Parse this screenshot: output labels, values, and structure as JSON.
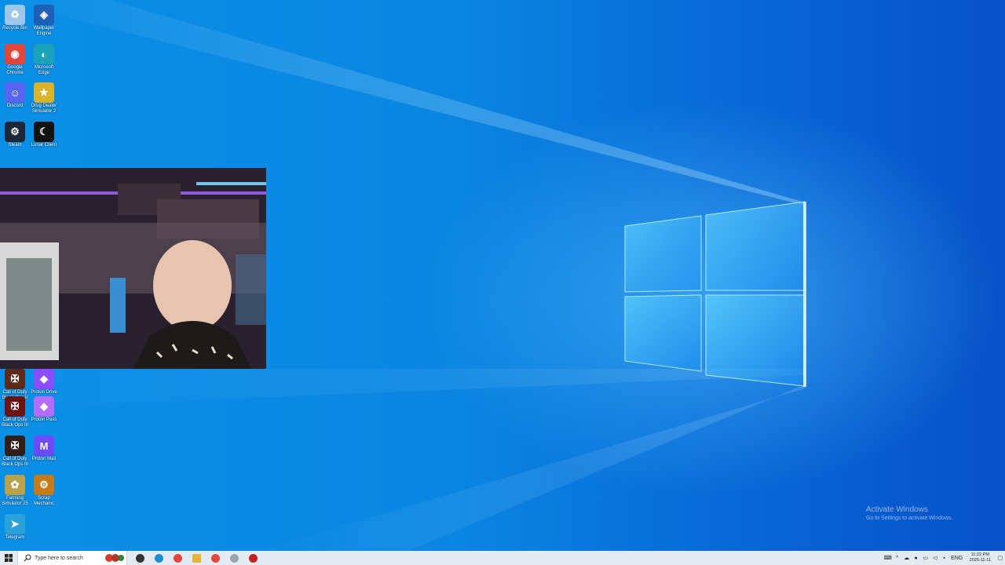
{
  "desktop": {
    "icons": [
      {
        "label": "Recycle Bin",
        "icon": "recycle-bin-icon",
        "color": "#9cc7ea"
      },
      {
        "label": "Wallpaper Engine",
        "icon": "wallpaper-engine-icon",
        "color": "#1e5fb8"
      },
      {
        "label": "Google Chrome",
        "icon": "chrome-icon",
        "color": "#e0463b"
      },
      {
        "label": "Microsoft Edge",
        "icon": "edge-icon",
        "color": "#1aa3b8"
      },
      {
        "label": "Discord",
        "icon": "discord-icon",
        "color": "#5865f2"
      },
      {
        "label": "Drug Dealer Simulator 2",
        "icon": "drug-dealer-simulator-icon",
        "color": "#d9b32a"
      },
      {
        "label": "Steam",
        "icon": "steam-icon",
        "color": "#1b2838"
      },
      {
        "label": "Lunar Client",
        "icon": "lunar-client-icon",
        "color": "#111111"
      },
      {
        "label": "Call of Duty Black Ops II",
        "icon": "call-of-duty-icon",
        "color": "#5c2a1a"
      },
      {
        "label": "Proton Drive",
        "icon": "proton-drive-icon",
        "color": "#8a4dff"
      },
      {
        "label": "Call of Duty Black Ops III",
        "icon": "call-of-duty-icon",
        "color": "#6b1414"
      },
      {
        "label": "Proton Pass",
        "icon": "proton-pass-icon",
        "color": "#b56cff"
      },
      {
        "label": "Call of Duty Black Ops III",
        "icon": "call-of-duty-icon",
        "color": "#2f1d16"
      },
      {
        "label": "Proton Mail",
        "icon": "proton-mail-icon",
        "color": "#6d4aff"
      },
      {
        "label": "Farming Simulator 25",
        "icon": "farming-simulator-icon",
        "color": "#b9a24a"
      },
      {
        "label": "Scrap Mechanic",
        "icon": "scrap-mechanic-icon",
        "color": "#c87a16"
      },
      {
        "label": "Telegram",
        "icon": "telegram-icon",
        "color": "#2aa1da"
      }
    ]
  },
  "watermark": {
    "title": "Activate Windows",
    "subtitle": "Go to Settings to activate Windows."
  },
  "taskbar": {
    "search_placeholder": "Type here to search",
    "apps": [
      "task-view-icon",
      "edge-icon",
      "chrome-icon",
      "file-explorer-icon",
      "chrome-icon",
      "app-icon",
      "obs-icon"
    ],
    "tray_lang": "ENG",
    "time": "11:22 PM",
    "date": "2025-11-11"
  }
}
